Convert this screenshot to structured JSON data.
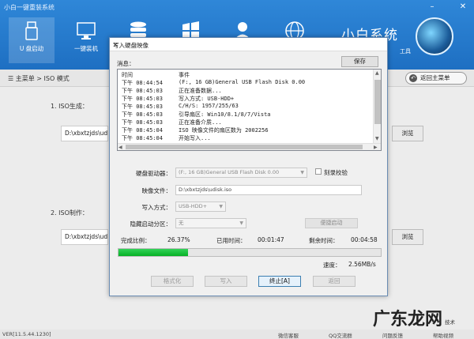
{
  "app": {
    "title": "小白一键重装系统"
  },
  "window_controls": {
    "minimize": "–",
    "close": "✕"
  },
  "nav": [
    {
      "label": "U 盘启动",
      "icon": "usb-drive-icon"
    },
    {
      "label": "一键装机",
      "icon": "monitor-icon"
    },
    {
      "label": "",
      "icon": "database-icon"
    },
    {
      "label": "",
      "icon": "windows-logo-icon"
    },
    {
      "label": "",
      "icon": "user-icon"
    },
    {
      "label": "",
      "icon": "globe-icon"
    }
  ],
  "brand": {
    "name": "小白系统",
    "sub": "工具"
  },
  "breadcrumb": {
    "text": "☰ 主菜单  >  ISO 模式",
    "back_label": "返回主菜单"
  },
  "sections": {
    "iso_gen": {
      "label": "1.  ISO生成：",
      "path": "D:\\xbxtzjds\\udi",
      "button": "浏览"
    },
    "iso_make": {
      "label": "2.  ISO制作：",
      "path": "D:\\xbxtzjds\\udi",
      "button": "浏览"
    }
  },
  "dialog": {
    "title": "写入硬盘映像",
    "close_glyph": "×",
    "message_label": "消息：",
    "save_label": "保存",
    "log_headers": {
      "time": "时间",
      "event": "事件"
    },
    "log": [
      {
        "time": "下午 08:44:54",
        "event": "(F:, 16 GB)General USB Flash Disk  0.00"
      },
      {
        "time": "下午 08:45:03",
        "event": "正在准备数据..."
      },
      {
        "time": "下午 08:45:03",
        "event": "写入方式: USB-HDD+"
      },
      {
        "time": "下午 08:45:03",
        "event": "C/H/S: 1957/255/63"
      },
      {
        "time": "下午 08:45:03",
        "event": "引导扇区: Win10/8.1/8/7/Vista"
      },
      {
        "time": "下午 08:45:03",
        "event": "正在准备介质..."
      },
      {
        "time": "下午 08:45:04",
        "event": "ISO 映像文件的扇区数为 2002256"
      },
      {
        "time": "下午 08:45:04",
        "event": "开始写入..."
      }
    ],
    "form": {
      "drive_label": "硬盘驱动器：",
      "drive_value": "(F:, 16 GB)General USB Flash Disk  0.00",
      "verify_label": "刻录校验",
      "image_label": "映像文件：",
      "image_value": "D:\\xbxtzjds\\udisk.iso",
      "write_label": "写入方式：",
      "write_value": "USB-HDD+",
      "hidden_label": "隐藏启动分区：",
      "hidden_value": "无",
      "boot_btn": "便捷启动"
    },
    "progress": {
      "done_label": "完成比例：",
      "done_value": "26.37%",
      "elapsed_label": "已用时间：",
      "elapsed_value": "00:01:47",
      "remain_label": "剩余时间：",
      "remain_value": "00:04:58",
      "fraction": 0.2637,
      "speed_label": "速度：",
      "speed_value": "2.56MB/s"
    },
    "buttons": {
      "format": "格式化",
      "write": "写入",
      "stop": "终止[A]",
      "back": "返回"
    }
  },
  "status": {
    "version": "VER[11.5.44.1230]",
    "wechat": "微信客服",
    "qq": "QQ交流群",
    "feedback": "问题反馈",
    "help": "帮助视频"
  },
  "watermark": {
    "text": "广东龙网",
    "mini": "技术"
  },
  "colors": {
    "topbar": "#2f87d8",
    "progress": "#06b025"
  }
}
